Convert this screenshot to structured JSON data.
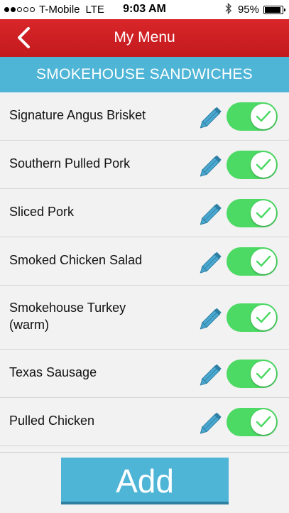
{
  "status_bar": {
    "carrier": "T-Mobile",
    "network": "LTE",
    "time": "9:03 AM",
    "battery_percent": "95%",
    "battery_level": 0.95,
    "bluetooth_icon": "bluetooth-icon"
  },
  "navbar": {
    "title": "My Menu",
    "back_icon": "chevron-left-icon"
  },
  "section": {
    "title": "SMOKEHOUSE SANDWICHES"
  },
  "items": [
    {
      "label": "Signature Angus Brisket",
      "enabled": true
    },
    {
      "label": "Southern Pulled Pork",
      "enabled": true
    },
    {
      "label": "Sliced Pork",
      "enabled": true
    },
    {
      "label": "Smoked Chicken Salad",
      "enabled": true
    },
    {
      "label": "Smokehouse Turkey\n(warm)",
      "enabled": true
    },
    {
      "label": "Texas Sausage",
      "enabled": true
    },
    {
      "label": "Pulled Chicken",
      "enabled": true
    }
  ],
  "footer": {
    "add_label": "Add"
  },
  "colors": {
    "navbar": "#c91f23",
    "accent": "#4eb5d6",
    "toggle_on": "#4cd964"
  }
}
